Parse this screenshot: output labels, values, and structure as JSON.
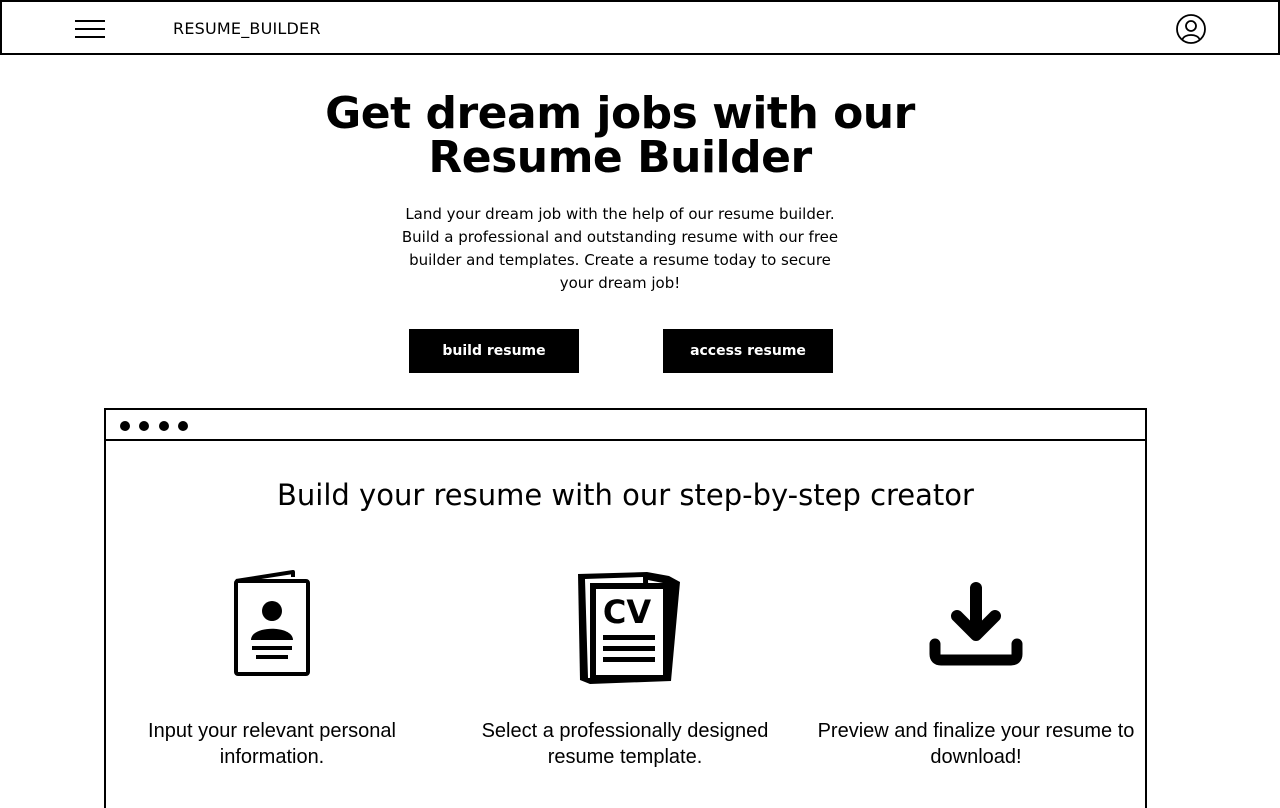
{
  "header": {
    "brand": "RESUME_BUILDER",
    "menu_icon": "hamburger-menu-icon",
    "profile_icon": "user-circle-icon"
  },
  "hero": {
    "title": "Get dream jobs with our Resume Builder",
    "subtitle": "Land your dream job with the help of our resume builder. Build a professional and outstanding resume with our free builder and templates. Create a resume today to secure your dream job!",
    "build_button": "build resume",
    "access_button": "access resume"
  },
  "creator": {
    "title": "Build your resume with our step-by-step creator",
    "steps": [
      {
        "icon": "personal-info-card-icon",
        "text": "Input your relevant personal information."
      },
      {
        "icon": "cv-document-icon",
        "text": "Select a professionally designed resume template."
      },
      {
        "icon": "download-icon",
        "text": "Preview and finalize your resume to download!"
      }
    ]
  },
  "colors": {
    "primary": "#000000",
    "background": "#ffffff",
    "button_text": "#ffffff"
  }
}
